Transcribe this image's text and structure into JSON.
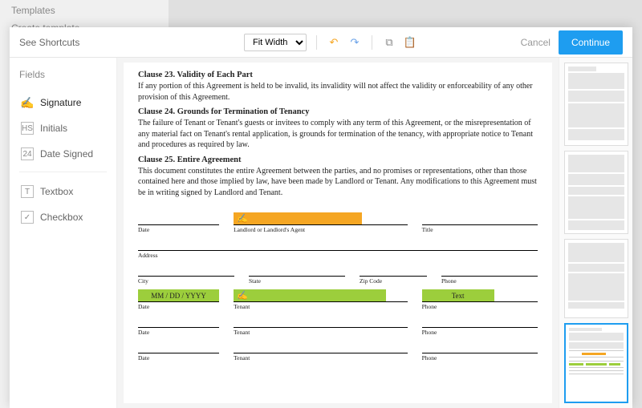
{
  "bg": {
    "templates": "Templates",
    "create_template": "Create template"
  },
  "header": {
    "shortcuts": "See Shortcuts",
    "zoom_options": [
      "Fit Width"
    ],
    "zoom_selected": "Fit Width",
    "cancel": "Cancel",
    "continue": "Continue"
  },
  "fields": {
    "title": "Fields",
    "items": [
      {
        "label": "Signature",
        "icon": "✍",
        "kind": "signature"
      },
      {
        "label": "Initials",
        "icon": "HS",
        "kind": "initials"
      },
      {
        "label": "Date Signed",
        "icon": "24",
        "kind": "date"
      }
    ],
    "items2": [
      {
        "label": "Textbox",
        "icon": "T",
        "kind": "textbox"
      },
      {
        "label": "Checkbox",
        "icon": "✓",
        "kind": "checkbox"
      }
    ]
  },
  "doc": {
    "clauses": [
      {
        "title": "Clause 23. Validity of Each Part",
        "body": "If any portion of this Agreement is held to be invalid, its invalidity will not affect the validity or enforceability of any other provision of this Agreement."
      },
      {
        "title": "Clause 24. Grounds for Termination of Tenancy",
        "body": "The failure of Tenant or Tenant's guests or invitees to comply with any term of this Agreement, or the misrepresentation of any material fact on Tenant's rental application, is grounds for termination of the tenancy, with appropriate notice to Tenant and procedures as required by law."
      },
      {
        "title": "Clause 25. Entire Agreement",
        "body": "This document constitutes the entire Agreement between the parties, and no promises or representations, other than those contained here and those implied by law, have been made by Landlord or Tenant. Any modifications to this Agreement must be in writing signed by Landlord and Tenant."
      }
    ],
    "form_labels": {
      "date": "Date",
      "landlord": "Landlord or Landlord's Agent",
      "title": "Title",
      "address": "Address",
      "city": "City",
      "state": "State",
      "zip": "Zip Code",
      "phone": "Phone",
      "tenant": "Tenant"
    },
    "placed_fields": {
      "date_placeholder": "MM / DD / YYYY",
      "text_placeholder": "Text"
    }
  },
  "colors": {
    "primary": "#1e9df0",
    "signer1": "#f5a623",
    "signer2": "#9cce3c"
  }
}
